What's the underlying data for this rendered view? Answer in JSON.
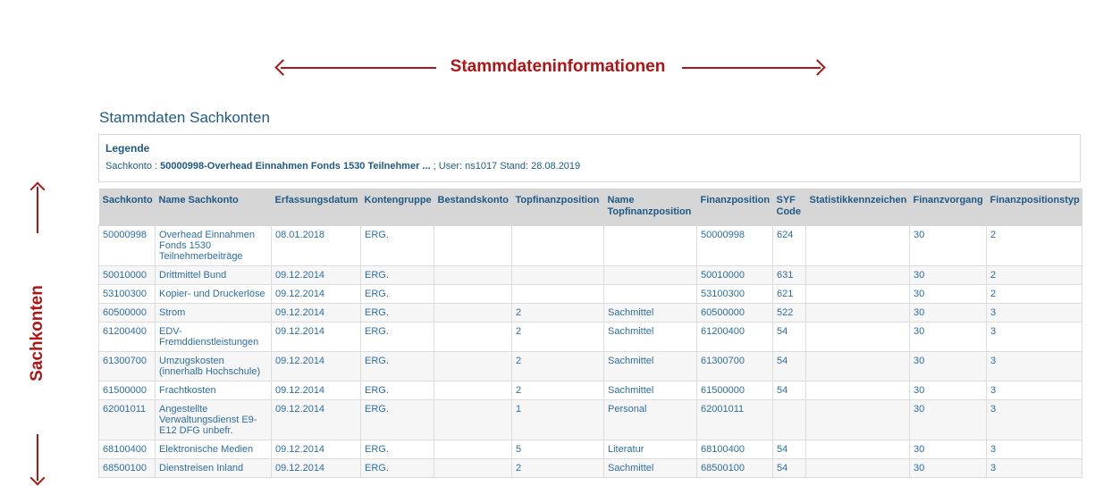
{
  "annotations": {
    "top_label": "Stammdateninformationen",
    "left_label": "Sachkonten"
  },
  "page": {
    "title": "Stammdaten Sachkonten"
  },
  "legend": {
    "title": "Legende",
    "sachkonto_label": "Sachkonto :",
    "sachkonto_value": "50000998-Overhead Einnahmen Fonds 1530 Teilnehmer ...",
    "user_text": "; User: ns1017",
    "stand_text": "Stand: 28.08.2019"
  },
  "table": {
    "headers": {
      "sachkonto": "Sachkonto",
      "name": "Name Sachkonto",
      "erfassungsdatum": "Erfassungsdatum",
      "kontengruppe": "Kontengruppe",
      "bestandskonto": "Bestandskonto",
      "topfinanzposition": "Topfinanzposition",
      "name_top": "Name Topfinanzposition",
      "finanzposition": "Finanzposition",
      "syf_code": "SYF Code",
      "statistik": "Statistikkennzeichen",
      "finanzvorgang": "Finanzvorgang",
      "finanzpositionstyp": "Finanzpositionstyp"
    },
    "rows": [
      {
        "sachkonto": "50000998",
        "name": "Overhead Einnahmen Fonds 1530 Teilnehmerbeiträge",
        "datum": "08.01.2018",
        "gruppe": "ERG.",
        "bestand": "",
        "top": "",
        "name_top": "",
        "finanz": "50000998",
        "syf": "624",
        "statistik": "",
        "vorgang": "30",
        "typ": "2"
      },
      {
        "sachkonto": "50010000",
        "name": "Drittmittel Bund",
        "datum": "09.12.2014",
        "gruppe": "ERG.",
        "bestand": "",
        "top": "",
        "name_top": "",
        "finanz": "50010000",
        "syf": "631",
        "statistik": "",
        "vorgang": "30",
        "typ": "2"
      },
      {
        "sachkonto": "53100300",
        "name": "Kopier- und Druckerlöse",
        "datum": "09.12.2014",
        "gruppe": "ERG.",
        "bestand": "",
        "top": "",
        "name_top": "",
        "finanz": "53100300",
        "syf": "621",
        "statistik": "",
        "vorgang": "30",
        "typ": "2"
      },
      {
        "sachkonto": "60500000",
        "name": "Strom",
        "datum": "09.12.2014",
        "gruppe": "ERG.",
        "bestand": "",
        "top": "2",
        "name_top": "Sachmittel",
        "finanz": "60500000",
        "syf": "522",
        "statistik": "",
        "vorgang": "30",
        "typ": "3"
      },
      {
        "sachkonto": "61200400",
        "name": "EDV-Fremddienstleistungen",
        "datum": "09.12.2014",
        "gruppe": "ERG.",
        "bestand": "",
        "top": "2",
        "name_top": "Sachmittel",
        "finanz": "61200400",
        "syf": "54",
        "statistik": "",
        "vorgang": "30",
        "typ": "3"
      },
      {
        "sachkonto": "61300700",
        "name": "Umzugskosten (innerhalb Hochschule)",
        "datum": "09.12.2014",
        "gruppe": "ERG.",
        "bestand": "",
        "top": "2",
        "name_top": "Sachmittel",
        "finanz": "61300700",
        "syf": "54",
        "statistik": "",
        "vorgang": "30",
        "typ": "3"
      },
      {
        "sachkonto": "61500000",
        "name": "Frachtkosten",
        "datum": "09.12.2014",
        "gruppe": "ERG.",
        "bestand": "",
        "top": "2",
        "name_top": "Sachmittel",
        "finanz": "61500000",
        "syf": "54",
        "statistik": "",
        "vorgang": "30",
        "typ": "3"
      },
      {
        "sachkonto": "62001011",
        "name": "Angestellte Verwaltungsdienst E9-E12 DFG unbefr.",
        "datum": "09.12.2014",
        "gruppe": "ERG.",
        "bestand": "",
        "top": "1",
        "name_top": "Personal",
        "finanz": "62001011",
        "syf": "",
        "statistik": "",
        "vorgang": "30",
        "typ": "3"
      },
      {
        "sachkonto": "68100400",
        "name": "Elektronische Medien",
        "datum": "09.12.2014",
        "gruppe": "ERG.",
        "bestand": "",
        "top": "5",
        "name_top": "Literatur",
        "finanz": "68100400",
        "syf": "54",
        "statistik": "",
        "vorgang": "30",
        "typ": "3"
      },
      {
        "sachkonto": "68500100",
        "name": "Dienstreisen Inland",
        "datum": "09.12.2014",
        "gruppe": "ERG.",
        "bestand": "",
        "top": "2",
        "name_top": "Sachmittel",
        "finanz": "68500100",
        "syf": "54",
        "statistik": "",
        "vorgang": "30",
        "typ": "3"
      }
    ]
  }
}
